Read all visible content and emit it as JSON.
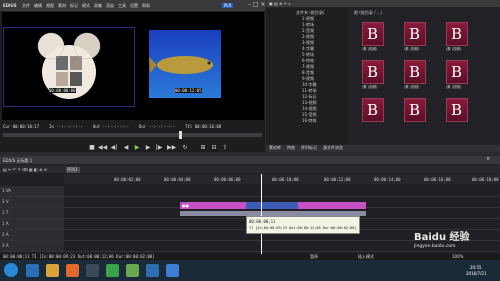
{
  "app": {
    "title": "EDIUS",
    "menu": [
      "文件",
      "编辑",
      "视图",
      "素材",
      "标记",
      "模式",
      "采集",
      "渲染",
      "工具",
      "设置",
      "帮助"
    ],
    "mode_badge": "PLR"
  },
  "preview": {
    "source_timecode": "00:00:00:00",
    "record_timecode": "00:00:12:05",
    "cur_label": "Cur 00:00:10:17",
    "in_label": "In --:--:--:--",
    "out_label": "Out --:--:--:--",
    "dur_label": "Dur --:--:--:--",
    "ttl_label": "Ttl 00:00:16:08"
  },
  "bin": {
    "title": "根 (根目录 / ...)",
    "tree": [
      "文件夹 (根目录)",
      "1-视频",
      "1-转场",
      "2-音频",
      "2-视频",
      "3-视频",
      "4-字幕",
      "5-转场",
      "6-特效",
      "7-视频",
      "8-音频",
      "9-视频",
      "10-字幕",
      "11-转场",
      "12-标记",
      "13-视频",
      "14-视频",
      "15-音频",
      "16-特效"
    ],
    "tabs": [
      "素材库",
      "特效",
      "序列标记",
      "源文件浏览"
    ],
    "thumb_labels": [
      "\\素 (视频)",
      "\\素 (视频)",
      "\\素 (视频)",
      "\\素 (视频)",
      "\\素 (视频)",
      "\\素 (视频)"
    ]
  },
  "timeline": {
    "title": "EDIUS 无标题 1",
    "sequence_tab": "序列1",
    "tracks": [
      "1 VA",
      "2 V",
      "1 T",
      "1 A",
      "2 A",
      "3 A",
      "4 A"
    ],
    "ruler_times": [
      "00:00:00;00",
      "00:00:02;00",
      "00:00:04;00",
      "00:00:06;00",
      "00:00:08;00",
      "00:00:10;00",
      "00:00:12;00",
      "00:00:14;00",
      "00:00:16;00",
      "00:00:18;00",
      "00:00:20;00"
    ],
    "tooltip_line1": "00:00:00;11",
    "tooltip_line2": "T1 [In:00:00:09;23 Out:00:00:12;06 Dur:00:00:02;08]",
    "status_left": "00:00:00;11 T1 [In:00:00:09;23 Out:00:00:12;06 Dur:00:00:02;08]",
    "status_right": [
      "暂停",
      "插入模式",
      "100%"
    ]
  },
  "taskbar": {
    "time": "20:55",
    "date": "2016/7/21"
  },
  "watermark": {
    "text": "Baidu 经验",
    "url": "jingyan.baidu.com"
  },
  "colors": {
    "clip_magenta": "#c64fc6",
    "clip_blue": "#3f5bb8",
    "playhead": "#ffffff",
    "thumb_red": "#7a1531"
  }
}
